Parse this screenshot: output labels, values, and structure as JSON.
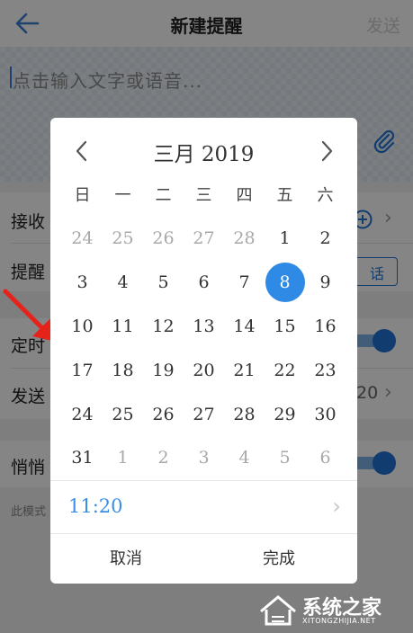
{
  "header": {
    "title": "新建提醒",
    "send_label": "发送"
  },
  "editor": {
    "placeholder": "点击输入文字或语音..."
  },
  "rows": [
    {
      "label": "接收"
    },
    {
      "label": "提醒"
    },
    {
      "label": "定时"
    },
    {
      "label": "发送",
      "value": "20"
    },
    {
      "label": "悄悄"
    }
  ],
  "call_button_label": "话",
  "hint": "此模式",
  "watermark": {
    "text": "系统之家",
    "url": "XITONGZHIJIA.NET"
  },
  "picker": {
    "month_title": "三月 2019",
    "weekdays": [
      "日",
      "一",
      "二",
      "三",
      "四",
      "五",
      "六"
    ],
    "weeks": [
      [
        "24",
        "25",
        "26",
        "27",
        "28",
        "1",
        "2"
      ],
      [
        "3",
        "4",
        "5",
        "6",
        "7",
        "8",
        "9"
      ],
      [
        "10",
        "11",
        "12",
        "13",
        "14",
        "15",
        "16"
      ],
      [
        "17",
        "18",
        "19",
        "20",
        "21",
        "22",
        "23"
      ],
      [
        "24",
        "25",
        "26",
        "27",
        "28",
        "29",
        "30"
      ],
      [
        "31",
        "1",
        "2",
        "3",
        "4",
        "5",
        "6"
      ]
    ],
    "selected_day": "8",
    "time": "11:20",
    "cancel_label": "取消",
    "confirm_label": "完成"
  },
  "colors": {
    "accent": "#2f8ae5",
    "time_text": "#3a8ee6",
    "toggle_on": "#1f73d6",
    "annotation_arrow": "#e5231b"
  }
}
